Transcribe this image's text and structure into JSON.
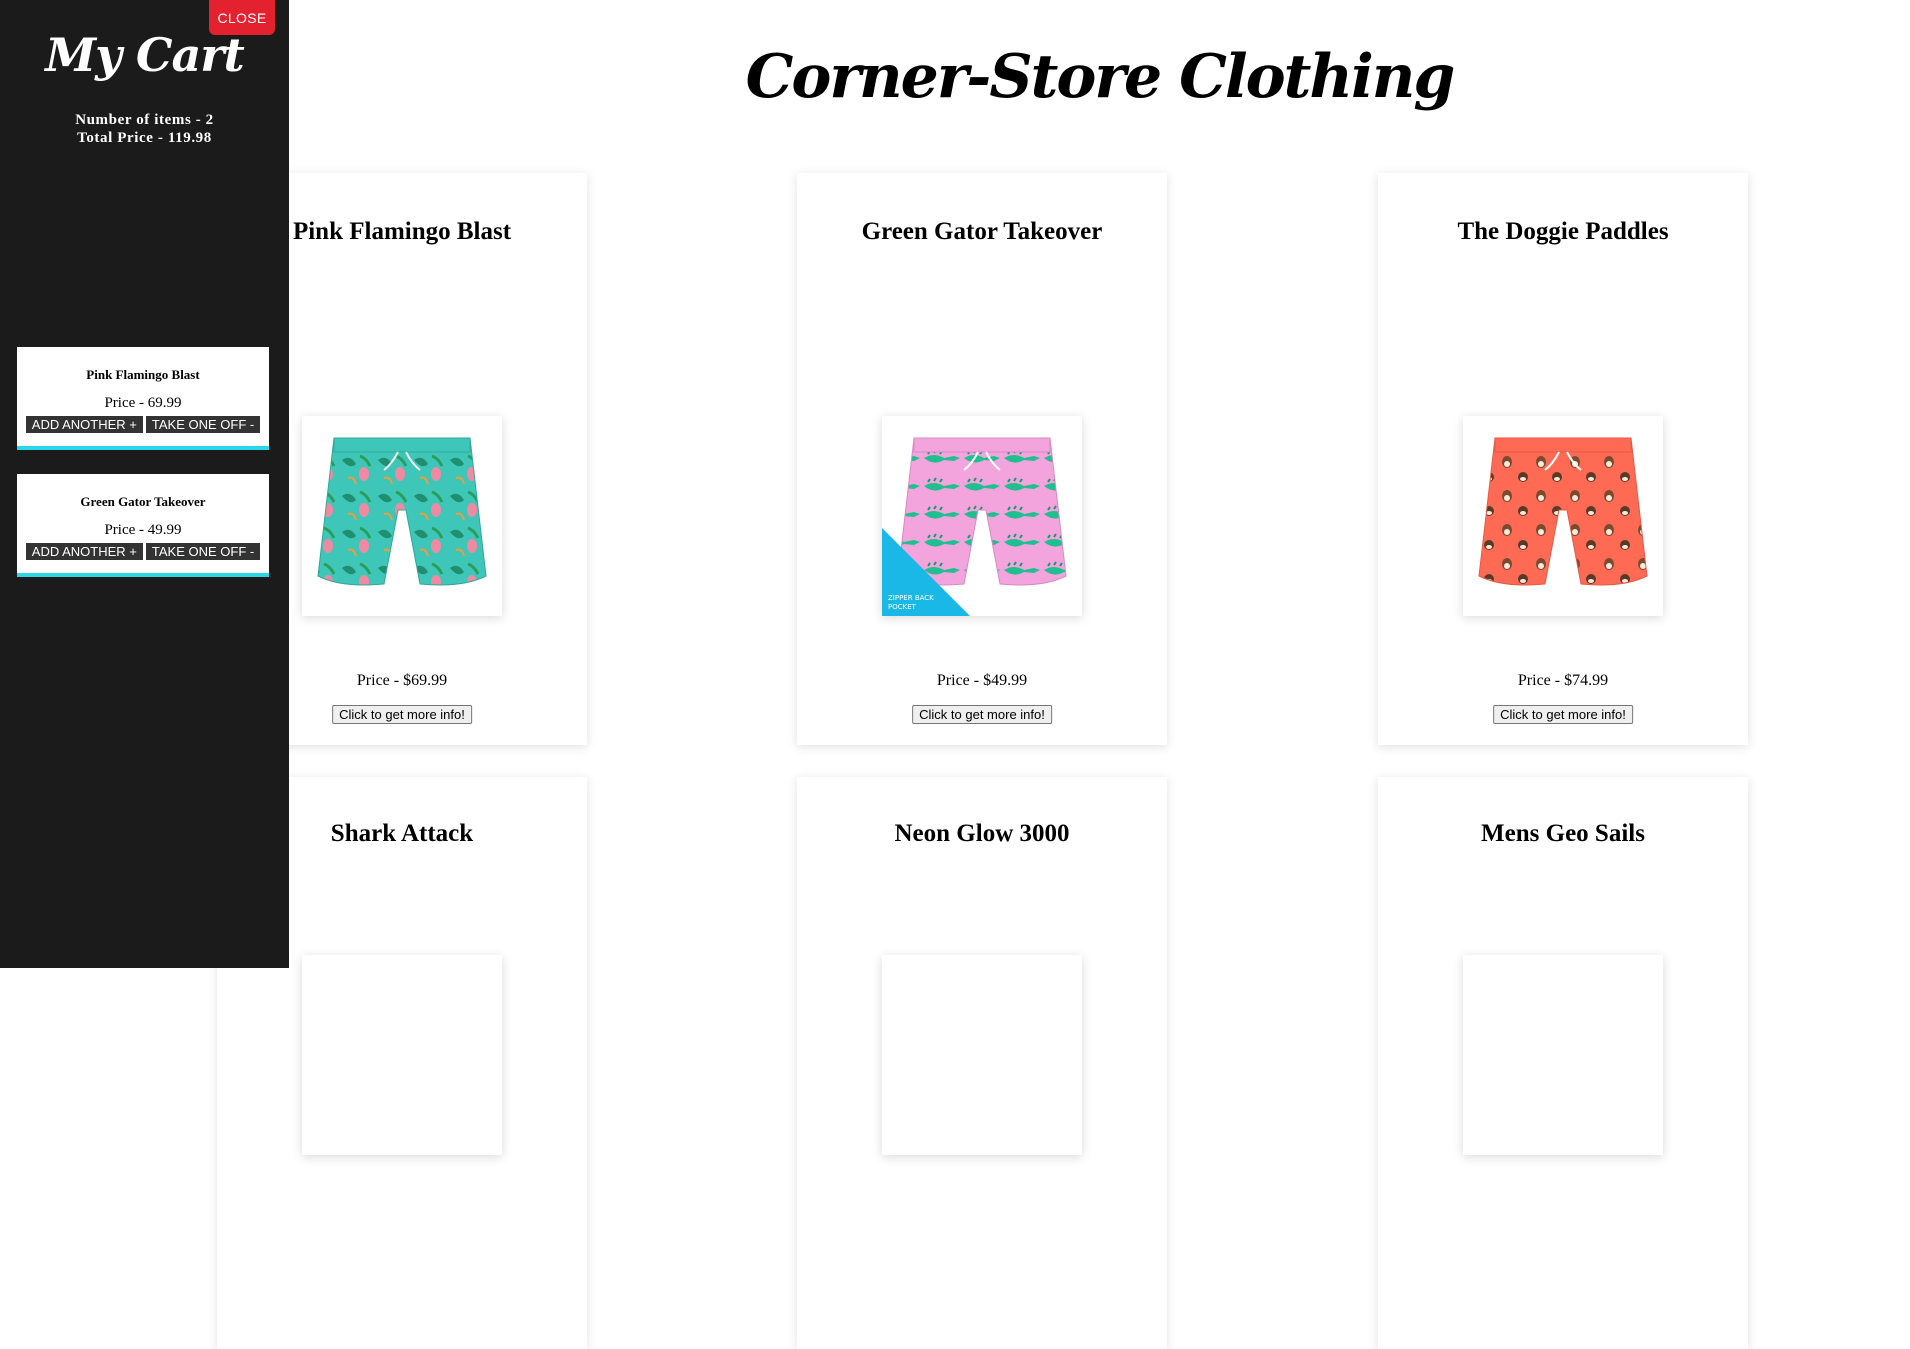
{
  "sidebar": {
    "close_label": "CLOSE",
    "title": "My Cart",
    "summary_items": "Number of items - 2",
    "summary_total": "Total Price - 119.98",
    "items": [
      {
        "name": "Pink Flamingo Blast",
        "price": "Price - 69.99",
        "add_label": "ADD ANOTHER +",
        "remove_label": "TAKE ONE OFF -"
      },
      {
        "name": "Green Gator Takeover",
        "price": "Price - 49.99",
        "add_label": "ADD ANOTHER +",
        "remove_label": "TAKE ONE OFF -"
      }
    ]
  },
  "store": {
    "title": "Corner-Store Clothing"
  },
  "products": [
    {
      "name": "Pink Flamingo Blast",
      "price": "Price - $69.99",
      "button": "Click to get more info!"
    },
    {
      "name": "Green Gator Takeover",
      "price": "Price - $49.99",
      "button": "Click to get more info!"
    },
    {
      "name": "The Doggie Paddles",
      "price": "Price - $74.99",
      "button": "Click to get more info!"
    },
    {
      "name": "Shark Attack"
    },
    {
      "name": "Neon Glow 3000"
    },
    {
      "name": "Mens Geo Sails"
    }
  ],
  "colors": {
    "sidebar_bg": "#1b1b1b",
    "close_button": "#e4212f",
    "cart_item_border": "#2ad7e8"
  }
}
